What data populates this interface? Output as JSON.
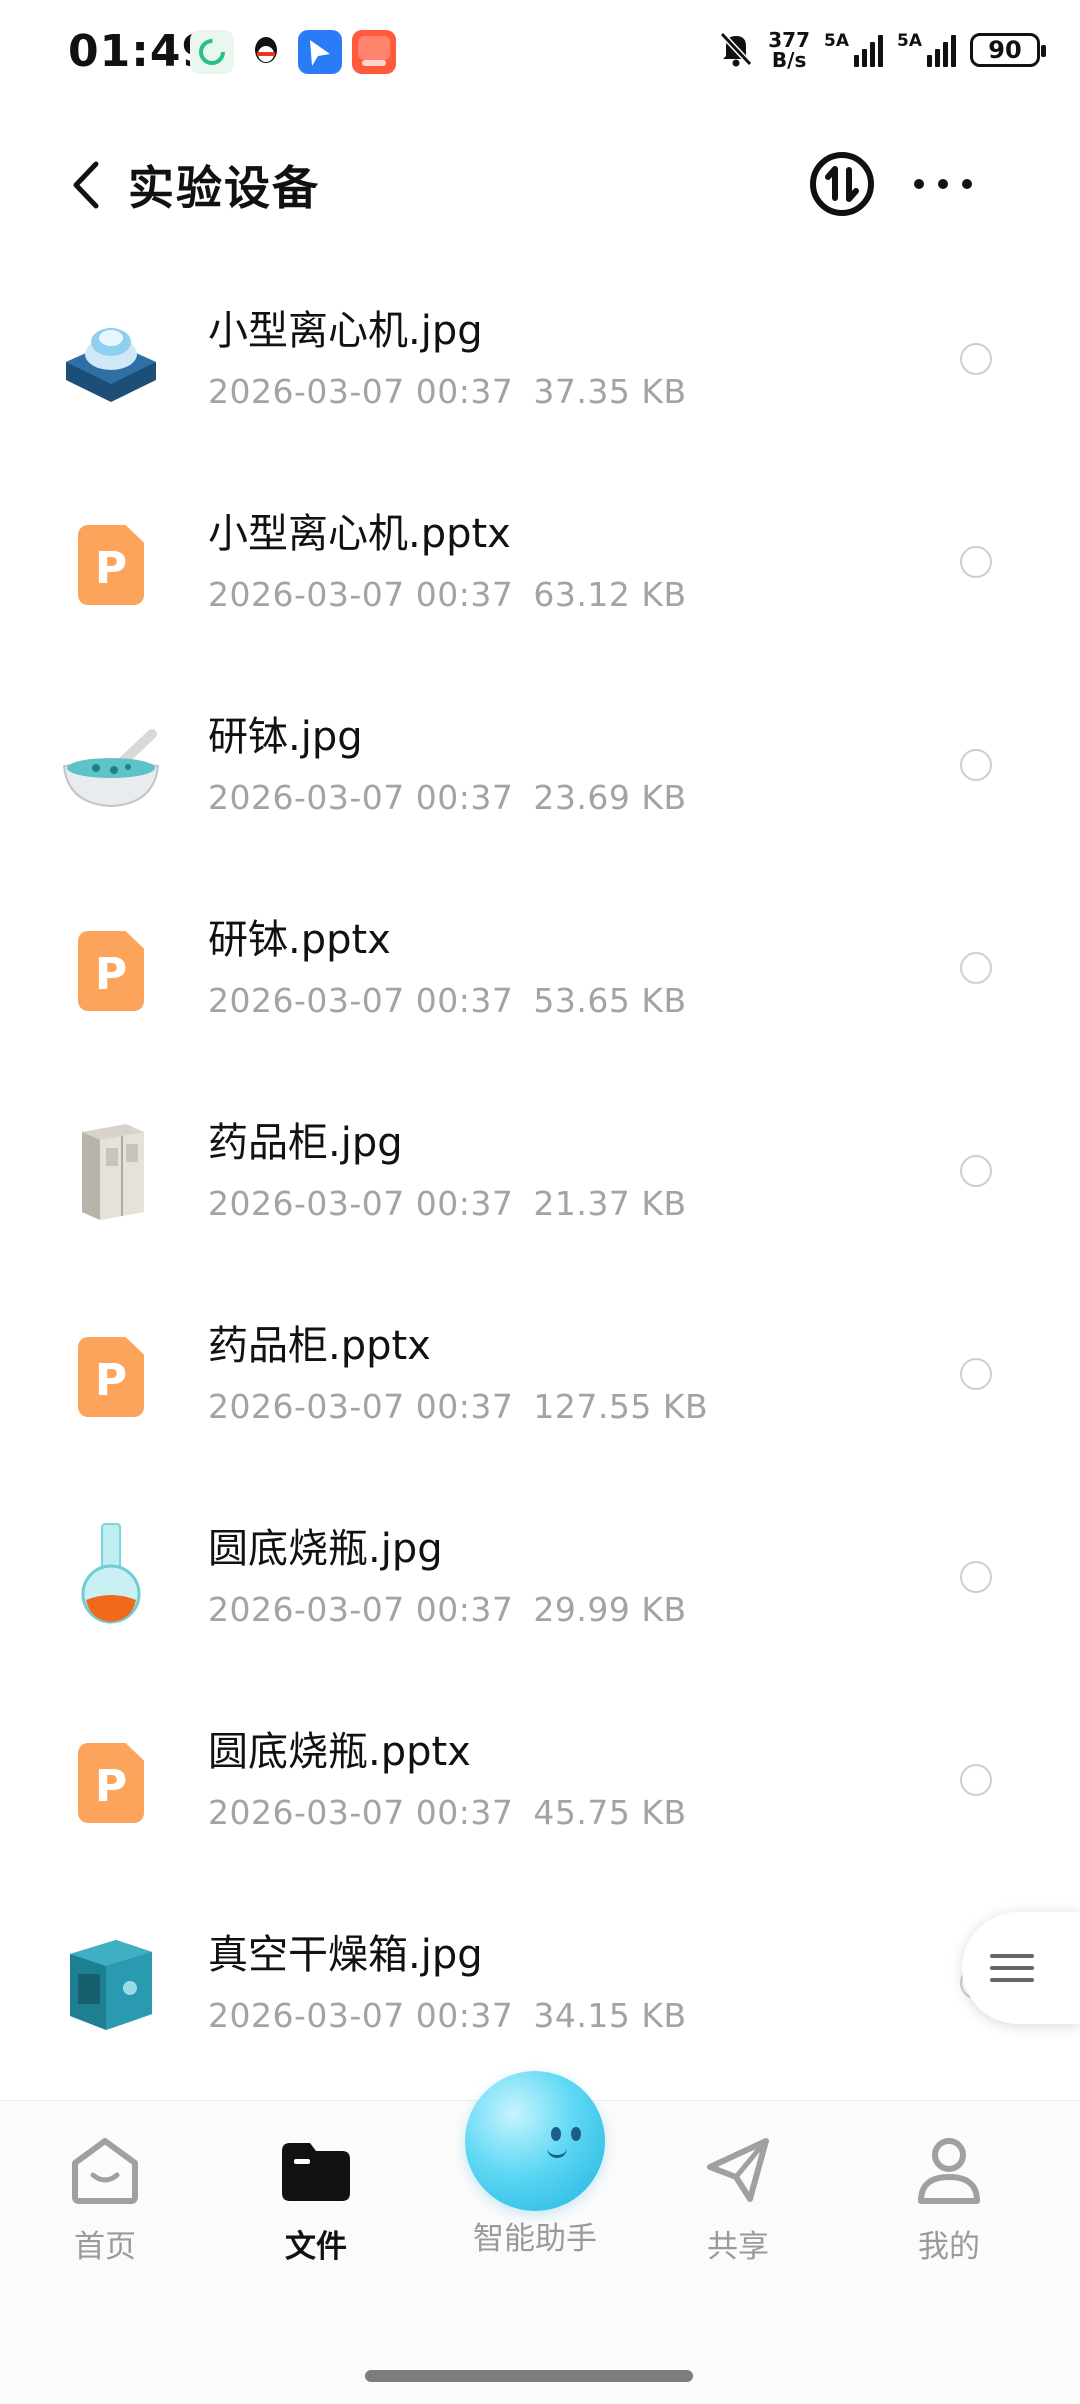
{
  "status_bar": {
    "time": "01:49",
    "net_speed_value": "377",
    "net_speed_unit": "B/s",
    "sim1_label": "5A",
    "sim2_label": "5A",
    "battery": "90"
  },
  "header": {
    "title": "实验设备"
  },
  "files": [
    {
      "name": "小型离心机.jpg",
      "date": "2026-03-07 00:37",
      "size": "37.35 KB",
      "type": "image",
      "icon": "centrifuge-thumbnail"
    },
    {
      "name": "小型离心机.pptx",
      "date": "2026-03-07 00:37",
      "size": "63.12 KB",
      "type": "pptx",
      "icon": "ppt-file-icon"
    },
    {
      "name": "研钵.jpg",
      "date": "2026-03-07 00:37",
      "size": "23.69 KB",
      "type": "image",
      "icon": "mortar-thumbnail"
    },
    {
      "name": "研钵.pptx",
      "date": "2026-03-07 00:37",
      "size": "53.65 KB",
      "type": "pptx",
      "icon": "ppt-file-icon"
    },
    {
      "name": "药品柜.jpg",
      "date": "2026-03-07 00:37",
      "size": "21.37 KB",
      "type": "image",
      "icon": "cabinet-thumbnail"
    },
    {
      "name": "药品柜.pptx",
      "date": "2026-03-07 00:37",
      "size": "127.55 KB",
      "type": "pptx",
      "icon": "ppt-file-icon"
    },
    {
      "name": "圆底烧瓶.jpg",
      "date": "2026-03-07 00:37",
      "size": "29.99 KB",
      "type": "image",
      "icon": "flask-thumbnail"
    },
    {
      "name": "圆底烧瓶.pptx",
      "date": "2026-03-07 00:37",
      "size": "45.75 KB",
      "type": "pptx",
      "icon": "ppt-file-icon"
    },
    {
      "name": "真空干燥箱.jpg",
      "date": "2026-03-07 00:37",
      "size": "34.15 KB",
      "type": "image",
      "icon": "oven-thumbnail"
    }
  ],
  "bottom_nav": {
    "home": "首页",
    "files": "文件",
    "assistant": "智能助手",
    "share": "共享",
    "me": "我的"
  },
  "colors": {
    "ppt_orange": "#fca45b",
    "meta_gray": "#a3a3a3",
    "assistant_blue": "#5fd8f4"
  }
}
